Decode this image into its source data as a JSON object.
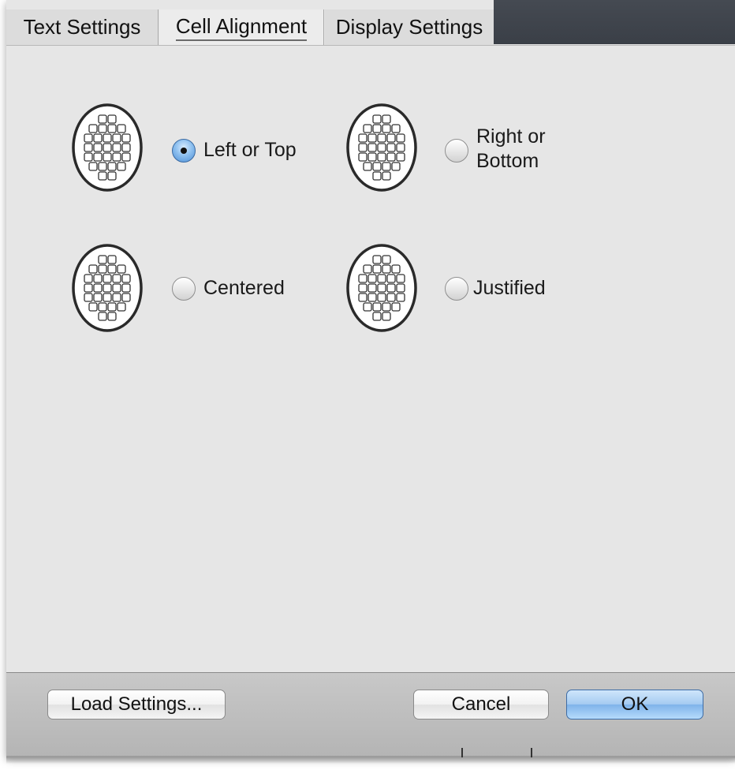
{
  "tabs": [
    {
      "label": "Text Settings",
      "selected": false
    },
    {
      "label": "Cell Alignment",
      "selected": true
    },
    {
      "label": "Display Settings",
      "selected": false
    }
  ],
  "alignment_options": [
    {
      "label": "Left or Top",
      "selected": true
    },
    {
      "label_line1": "Right or",
      "label_line2": "Bottom",
      "selected": false
    },
    {
      "label": "Centered",
      "selected": false
    },
    {
      "label": "Justified",
      "selected": false
    }
  ],
  "buttons": {
    "load_settings": "Load Settings...",
    "cancel": "Cancel",
    "ok": "OK"
  },
  "colors": {
    "accent": "#7fb3ea",
    "panel": "#e6e6e6"
  }
}
